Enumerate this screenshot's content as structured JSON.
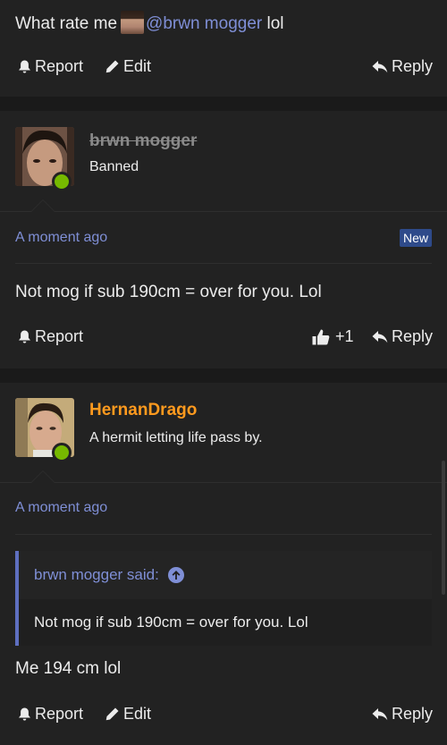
{
  "post1": {
    "text_before": "What rate me",
    "mention": "@brwn mogger",
    "text_after": "lol",
    "actions": {
      "report": "Report",
      "edit": "Edit",
      "reply": "Reply"
    }
  },
  "post2": {
    "username": "brwn mogger",
    "user_title": "Banned",
    "timestamp": "A moment ago",
    "badge": "New",
    "text": "Not mog if sub 190cm = over for you. Lol",
    "actions": {
      "report": "Report",
      "reaction_count": "+1",
      "reply": "Reply"
    }
  },
  "post3": {
    "username": "HernanDrago",
    "user_title": "A hermit letting life pass by.",
    "timestamp": "A moment ago",
    "quote": {
      "author": "brwn mogger said:",
      "text": "Not mog if sub 190cm = over for you. Lol"
    },
    "text": "Me 194 cm lol",
    "actions": {
      "report": "Report",
      "edit": "Edit",
      "reply": "Reply"
    }
  },
  "colors": {
    "link": "#7f8fd6",
    "username_highlight": "#ff9a1e",
    "username_banned": "#8a8a8a",
    "online": "#76b900",
    "badge_bg": "#2e4a8a",
    "quote_border": "#5e6fc0"
  }
}
